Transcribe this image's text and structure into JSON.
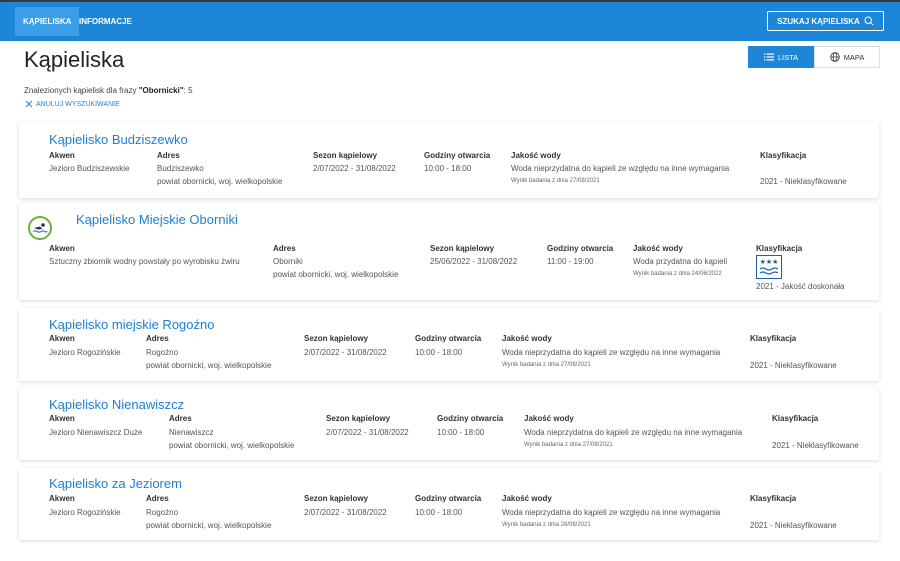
{
  "nav": {
    "tabs": [
      {
        "label": "KĄPIELISKA"
      },
      {
        "label": "INFORMACJE"
      }
    ],
    "search_label": "SZUKAJ KĄPIELISKA"
  },
  "header": {
    "title": "Kąpieliska",
    "view_list": "LISTA",
    "view_map": "MAPA",
    "results_prefix": "Znalezionych kąpielisk dla frazy ",
    "results_query": "\"Obornicki\"",
    "results_suffix": ": 5",
    "cancel_label": "ANULUJ WYSZUKIWANIE"
  },
  "labels": {
    "akwen": "Akwen",
    "adres": "Adres",
    "sezon": "Sezon kąpielowy",
    "godziny": "Godziny otwarcia",
    "jakosc": "Jakość wody",
    "klasyfikacja": "Klasyfikacja"
  },
  "colors": {
    "primary": "#1e86d6",
    "link": "#1e7fd0",
    "badge_green": "#67b33b"
  },
  "cards": [
    {
      "name": "Kąpielisko Budziszewko",
      "akwen": "Jezioro Budziszewskie",
      "adres_1": "Budziszewko",
      "adres_2": "powiat obornicki, woj. wielkopolskie",
      "sezon": "2/07/2022 - 31/08/2022",
      "godziny": "10:00 - 18:00",
      "jakosc": "Woda nieprzydatna do kąpieli ze względu na inne wymagania",
      "wynik": "Wynik badania z dnia 27/08/2021",
      "klasyfikacja": "2021 - Nieklasyfikowane"
    },
    {
      "name": "Kąpielisko Miejskie Oborniki",
      "akwen": "Sztuczny zbiornik wodny powstały po wyrobisku żwiru",
      "adres_1": "Oborniki",
      "adres_2": "powiat obornicki, woj. wielkopolskie",
      "sezon": "25/06/2022 - 31/08/2022",
      "godziny": "11:00 - 19:00",
      "jakosc": "Woda przydatna do kąpieli",
      "wynik": "Wynik badania z dnia 24/06/2022",
      "klasyfikacja": "2021 - Jakość doskonała",
      "badge_icon": "swimmer-icon",
      "class_icon": "excellent-quality-icon"
    },
    {
      "name": "Kąpielisko miejskie Rogoźno",
      "akwen": "Jezioro Rogozińskie",
      "adres_1": "Rogoźno",
      "adres_2": "powiat obornicki, woj. wielkopolskie",
      "sezon": "2/07/2022 - 31/08/2022",
      "godziny": "10:00 - 18:00",
      "jakosc": "Woda nieprzydatna do kąpieli ze względu na inne wymagania",
      "wynik": "Wynik badania z dnia 27/08/2021",
      "klasyfikacja": "2021 - Nieklasyfikowane"
    },
    {
      "name": "Kąpielisko Nienawiszcz",
      "akwen": "Jezioro Nienawiszcz Duże",
      "adres_1": "Nienawiszcz",
      "adres_2": "powiat obornicki, woj. wielkopolskie",
      "sezon": "2/07/2022 - 31/08/2022",
      "godziny": "10:00 - 18:00",
      "jakosc": "Woda nieprzydatna do kąpieli ze względu na inne wymagania",
      "wynik": "Wynik badania z dnia 27/08/2021",
      "klasyfikacja": "2021 - Nieklasyfikowane"
    },
    {
      "name": "Kąpielisko za Jeziorem",
      "akwen": "Jezioro Rogozińskie",
      "adres_1": "Rogoźno",
      "adres_2": "powiat obornicki, woj. wielkopolskie",
      "sezon": "2/07/2022 - 31/08/2022",
      "godziny": "10:00 - 18:00",
      "jakosc": "Woda nieprzydatna do kąpieli ze względu na inne wymagania",
      "wynik": "Wynik badania z dnia 28/08/2021",
      "klasyfikacja": "2021 - Nieklasyfikowane"
    }
  ]
}
